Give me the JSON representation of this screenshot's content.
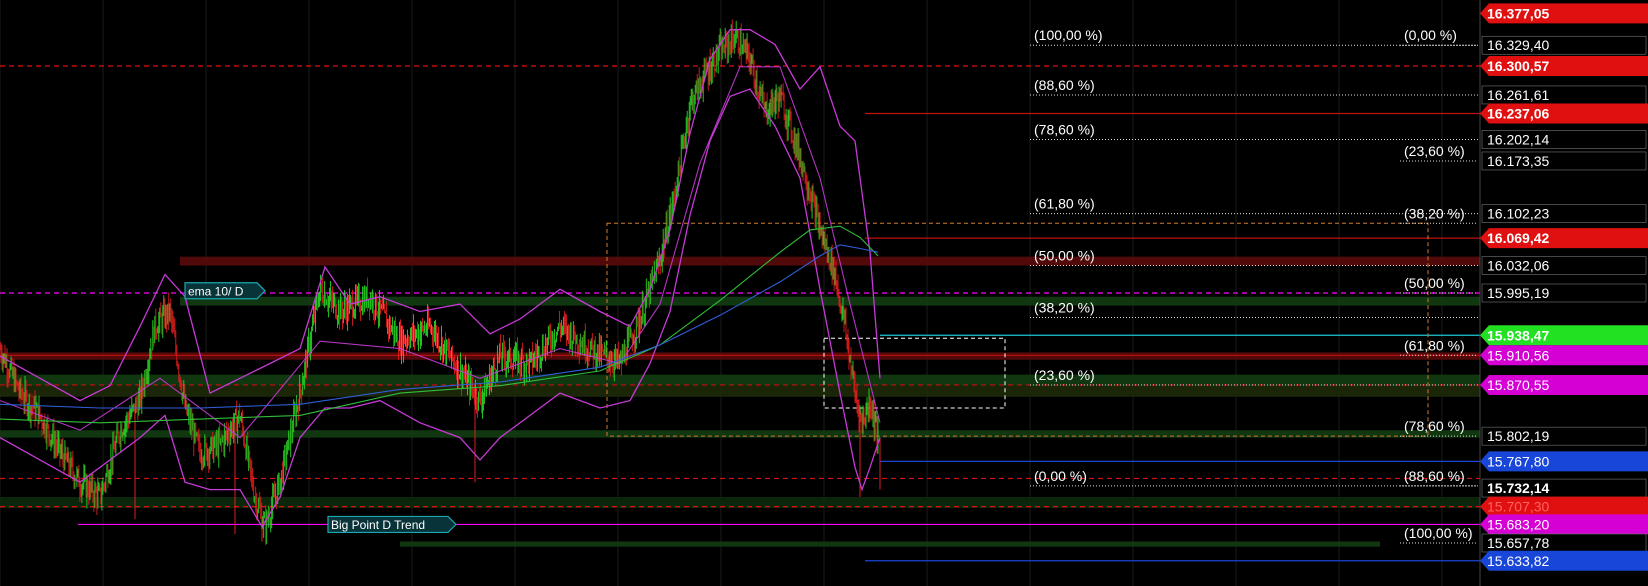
{
  "colors": {
    "background": "#000000",
    "grid": "#1c1c1c",
    "bull": "#26d926",
    "bear": "#e01e1e",
    "bollinger": "#c63ad6",
    "ema_green": "#2fbf3a",
    "ema_blue": "#2f5fd8",
    "fib_label": "#ffffff",
    "support_red": "#c01010",
    "support_green": "#0f4d12",
    "magenta": "#ff00ff"
  },
  "chart_data": {
    "type": "candlestick",
    "ylim": [
      15.6,
      16.39
    ],
    "ohlc_count": 880,
    "price_series": {
      "x": [
        0,
        20,
        40,
        60,
        80,
        100,
        120,
        140,
        155,
        170,
        185,
        200,
        220,
        240,
        255,
        265,
        280,
        300,
        320,
        340,
        370,
        400,
        430,
        460,
        480,
        500,
        530,
        560,
        590,
        620,
        640,
        660,
        675,
        690,
        705,
        720,
        735,
        750,
        765,
        780,
        800,
        820,
        835,
        845,
        855,
        862,
        870,
        878
      ],
      "y": [
        15.92,
        15.86,
        15.83,
        15.78,
        15.74,
        15.72,
        15.81,
        15.85,
        15.95,
        15.97,
        15.84,
        15.78,
        15.79,
        15.83,
        15.72,
        15.68,
        15.74,
        15.86,
        16.0,
        15.97,
        15.99,
        15.93,
        15.95,
        15.89,
        15.85,
        15.91,
        15.9,
        15.95,
        15.92,
        15.9,
        15.96,
        16.04,
        16.13,
        16.25,
        16.29,
        16.32,
        16.34,
        16.31,
        16.24,
        16.26,
        16.18,
        16.08,
        16.02,
        15.95,
        15.86,
        15.82,
        15.85,
        15.8
      ]
    },
    "ema_green": {
      "x": [
        0,
        100,
        200,
        300,
        400,
        500,
        600,
        660,
        720,
        780,
        810,
        840,
        860,
        878
      ],
      "y": [
        15.825,
        15.82,
        15.825,
        15.83,
        15.86,
        15.87,
        15.89,
        15.925,
        15.985,
        16.05,
        16.08,
        16.085,
        16.07,
        16.045
      ]
    },
    "ema_blue": {
      "x": [
        0,
        100,
        200,
        300,
        400,
        500,
        600,
        660,
        720,
        780,
        820,
        840,
        860,
        878
      ],
      "y": [
        15.845,
        15.84,
        15.84,
        15.845,
        15.865,
        15.875,
        15.895,
        15.925,
        15.965,
        16.01,
        16.045,
        16.06,
        16.055,
        16.05
      ]
    },
    "bollinger_upper": {
      "x": [
        0,
        40,
        80,
        110,
        140,
        165,
        185,
        210,
        240,
        270,
        300,
        325,
        350,
        380,
        420,
        460,
        490,
        520,
        560,
        600,
        630,
        650,
        670,
        690,
        710,
        730,
        750,
        775,
        800,
        820,
        840,
        855,
        870,
        880
      ],
      "y": [
        15.91,
        15.88,
        15.85,
        15.87,
        15.95,
        16.02,
        15.99,
        15.86,
        15.88,
        15.9,
        15.92,
        16.03,
        15.98,
        15.99,
        15.97,
        15.98,
        15.94,
        15.96,
        16.0,
        15.97,
        15.95,
        16.0,
        16.08,
        16.21,
        16.31,
        16.35,
        16.35,
        16.33,
        16.27,
        16.3,
        16.22,
        16.2,
        16.05,
        15.88
      ]
    },
    "bollinger_lower": {
      "x": [
        0,
        40,
        80,
        110,
        140,
        165,
        185,
        210,
        240,
        262,
        280,
        300,
        325,
        350,
        380,
        420,
        460,
        480,
        500,
        530,
        560,
        600,
        630,
        650,
        670,
        690,
        710,
        730,
        750,
        775,
        800,
        820,
        840,
        855,
        862,
        870,
        880
      ],
      "y": [
        15.8,
        15.77,
        15.74,
        15.77,
        15.8,
        15.83,
        15.74,
        15.73,
        15.73,
        15.68,
        15.72,
        15.8,
        15.84,
        15.84,
        15.85,
        15.82,
        15.8,
        15.77,
        15.8,
        15.83,
        15.86,
        15.84,
        15.85,
        15.9,
        15.97,
        16.1,
        16.2,
        16.26,
        16.27,
        16.22,
        16.15,
        16.0,
        15.86,
        15.76,
        15.73,
        15.76,
        15.8
      ]
    },
    "bollinger_mid": {
      "x": [
        0,
        80,
        160,
        240,
        320,
        400,
        480,
        560,
        620,
        660,
        700,
        740,
        780,
        820,
        850,
        880
      ],
      "y": [
        15.85,
        15.81,
        15.88,
        15.8,
        15.93,
        15.92,
        15.88,
        15.92,
        15.9,
        15.98,
        16.17,
        16.3,
        16.3,
        16.15,
        15.98,
        15.82
      ]
    },
    "right_axis_labels": [
      {
        "text": "16.377,05",
        "value": 16.372,
        "color": "#e01010",
        "text_color": "#ffffff",
        "bold": true
      },
      {
        "text": "16.329,40",
        "value": 16.329,
        "color": "#000000",
        "text_color": "#ffffff",
        "bold": false
      },
      {
        "text": "16.300,57",
        "value": 16.301,
        "color": "#e01010",
        "text_color": "#ffffff",
        "bold": true
      },
      {
        "text": "16.261,61",
        "value": 16.262,
        "color": "#000000",
        "text_color": "#ffffff",
        "bold": false
      },
      {
        "text": "16.237,06",
        "value": 16.237,
        "color": "#e01010",
        "text_color": "#ffffff",
        "bold": true
      },
      {
        "text": "16.202,14",
        "value": 16.202,
        "color": "#000000",
        "text_color": "#ffffff",
        "bold": false
      },
      {
        "text": "16.173,35",
        "value": 16.173,
        "color": "#000000",
        "text_color": "#ffffff",
        "bold": false
      },
      {
        "text": "16.102,23",
        "value": 16.102,
        "color": "#000000",
        "text_color": "#ffffff",
        "bold": false
      },
      {
        "text": "16.069,42",
        "value": 16.069,
        "color": "#e01010",
        "text_color": "#ffffff",
        "bold": true
      },
      {
        "text": "16.032,06",
        "value": 16.032,
        "color": "#000000",
        "text_color": "#ffffff",
        "bold": false
      },
      {
        "text": "15.995,19",
        "value": 15.995,
        "color": "#000000",
        "text_color": "#ffffff",
        "bold": false
      },
      {
        "text": "15.938,47",
        "value": 15.938,
        "color": "#22e022",
        "text_color": "#ffffff",
        "bold": true
      },
      {
        "text": "15.910,56",
        "value": 15.911,
        "color": "#d400d4",
        "text_color": "#ffffff",
        "bold": false
      },
      {
        "text": "15.870,55",
        "value": 15.871,
        "color": "#d400d4",
        "text_color": "#ffffff",
        "bold": false
      },
      {
        "text": "15.802,19",
        "value": 15.802,
        "color": "#000000",
        "text_color": "#ffffff",
        "bold": false
      },
      {
        "text": "15.767,80",
        "value": 15.768,
        "color": "#1846d8",
        "text_color": "#ffffff",
        "bold": false
      },
      {
        "text": "15.732,14",
        "value": 15.732,
        "color": "#000000",
        "text_color": "#ffffff",
        "bold": true
      },
      {
        "text": "15.707,30",
        "value": 15.707,
        "color": "#e01010",
        "text_color": "#ff6060",
        "bold": false
      },
      {
        "text": "15.683,20",
        "value": 15.683,
        "color": "#d400d4",
        "text_color": "#ffffff",
        "bold": false
      },
      {
        "text": "15.657,78",
        "value": 15.658,
        "color": "#000000",
        "text_color": "#ffffff",
        "bold": false
      },
      {
        "text": "15.633,82",
        "value": 15.634,
        "color": "#1846d8",
        "text_color": "#ffffff",
        "bold": false
      }
    ],
    "fib_left": [
      {
        "text": "(100,00 %)",
        "value": 16.329
      },
      {
        "text": "(88,60 %)",
        "value": 16.262
      },
      {
        "text": "(78,60 %)",
        "value": 16.202
      },
      {
        "text": "(61,80 %)",
        "value": 16.102
      },
      {
        "text": "(50,00 %)",
        "value": 16.032
      },
      {
        "text": "(38,20 %)",
        "value": 15.962
      },
      {
        "text": "(23,60 %)",
        "value": 15.871
      },
      {
        "text": "(0,00 %)",
        "value": 15.735
      }
    ],
    "fib_right": [
      {
        "text": "(0,00 %)",
        "value": 16.329
      },
      {
        "text": "(23,60 %)",
        "value": 16.173
      },
      {
        "text": "(38,20 %)",
        "value": 16.089
      },
      {
        "text": "(50,00 %)",
        "value": 15.995
      },
      {
        "text": "(61,80 %)",
        "value": 15.911
      },
      {
        "text": "(78,60 %)",
        "value": 15.802
      },
      {
        "text": "(88,60 %)",
        "value": 15.735
      },
      {
        "text": "(100,00 %)",
        "value": 15.658
      }
    ],
    "annotations": [
      {
        "text": "ema 10/ D",
        "value": 15.998,
        "color": "#1aa8b0"
      },
      {
        "text": "Big Point D Trend",
        "value": 15.683,
        "color": "#1aa8b0"
      }
    ],
    "horizontal_lines": [
      {
        "value": 16.301,
        "x_start": 0,
        "x_end": 1480,
        "color": "#e01010",
        "dash": true
      },
      {
        "value": 16.237,
        "x_start": 865,
        "x_end": 1480,
        "color": "#c01010",
        "dash": false
      },
      {
        "value": 16.069,
        "x_start": 865,
        "x_end": 1480,
        "color": "#c01010",
        "dash": false
      },
      {
        "value": 15.995,
        "x_start": 0,
        "x_end": 1480,
        "color": "#ff00ff",
        "dash": true
      },
      {
        "value": 15.938,
        "x_start": 880,
        "x_end": 1480,
        "color": "#1cc8d8",
        "dash": false
      },
      {
        "value": 15.911,
        "x_start": 0,
        "x_end": 1480,
        "color": "#c01010",
        "dash": false
      },
      {
        "value": 15.871,
        "x_start": 0,
        "x_end": 1480,
        "color": "#c01010",
        "dash": true
      },
      {
        "value": 15.768,
        "x_start": 880,
        "x_end": 1480,
        "color": "#1846d8",
        "dash": false
      },
      {
        "value": 15.745,
        "x_start": 0,
        "x_end": 1480,
        "color": "#e01010",
        "dash": true
      },
      {
        "value": 15.707,
        "x_start": 0,
        "x_end": 1480,
        "color": "#e01010",
        "dash": true
      },
      {
        "value": 15.683,
        "x_start": 78,
        "x_end": 1480,
        "color": "#ff00ff",
        "dash": false
      },
      {
        "value": 15.634,
        "x_start": 865,
        "x_end": 1480,
        "color": "#1846d8",
        "dash": false
      }
    ],
    "zones": [
      {
        "top": 16.044,
        "bottom": 16.032,
        "x_start": 180,
        "x_end": 1480,
        "color": "#5a0a0a"
      },
      {
        "top": 15.99,
        "bottom": 15.978,
        "x_start": 180,
        "x_end": 1480,
        "color": "#123d12"
      },
      {
        "top": 15.915,
        "bottom": 15.905,
        "x_start": 0,
        "x_end": 1480,
        "color": "#5a0a0a"
      },
      {
        "top": 15.885,
        "bottom": 15.87,
        "x_start": 0,
        "x_end": 1480,
        "color": "#123d12"
      },
      {
        "top": 15.87,
        "bottom": 15.855,
        "x_start": 0,
        "x_end": 1480,
        "color": "#1e2a0a"
      },
      {
        "top": 15.81,
        "bottom": 15.8,
        "x_start": 0,
        "x_end": 1480,
        "color": "#123d12"
      },
      {
        "top": 15.72,
        "bottom": 15.705,
        "x_start": 0,
        "x_end": 1480,
        "color": "#0d2a0d"
      },
      {
        "top": 15.66,
        "bottom": 15.653,
        "x_start": 400,
        "x_end": 1380,
        "color": "#123d12"
      }
    ],
    "dashed_boxes": [
      {
        "x_start": 607,
        "x_end": 1428,
        "y_top": 16.089,
        "y_bottom": 15.802,
        "color": "#d07a30"
      },
      {
        "x_start": 824,
        "x_end": 1005,
        "y_top": 15.934,
        "y_bottom": 15.84,
        "color": "#ffffff"
      }
    ]
  }
}
